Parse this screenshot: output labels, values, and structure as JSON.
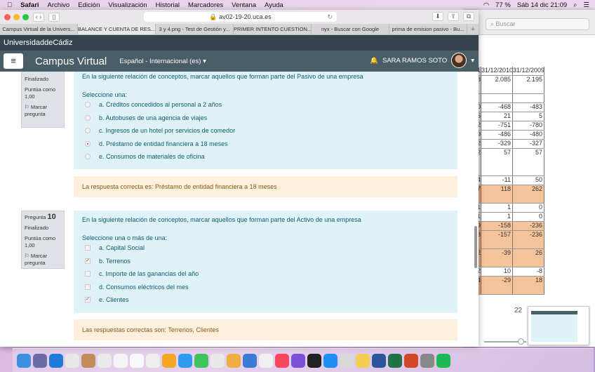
{
  "menubar": {
    "app": "Safari",
    "items": [
      "Archivo",
      "Edición",
      "Visualización",
      "Historial",
      "Marcadores",
      "Ventana",
      "Ayuda"
    ],
    "battery": "77 %",
    "datetime": "Sáb 14 dic  21:09"
  },
  "browser": {
    "url": "av02-19-20.uca.es",
    "tabs": [
      "Campus Virtual de la Univers...",
      "BALANCE Y CUENTA DE RES...",
      "3 y 4.png - Test de Gestión y...",
      "PRIMER INTENTO CUESTION...",
      "nyx - Buscar con Google",
      "prima de emision pasivo - Bu..."
    ]
  },
  "site": {
    "university": "UniversidaddeCádiz",
    "brand": "Campus Virtual",
    "language": "Español - Internacional (es)",
    "user": "SARA RAMOS SOTO"
  },
  "questions": [
    {
      "label": "Pregunta",
      "number": "9",
      "state": "Finalizado",
      "score": "Puntúa como 1,00",
      "flag": "Marcar pregunta",
      "text": "En la siguiente relación de conceptos, marcar aquellos que forman parte del Pasivo  de una empresa",
      "prompt": "Seleccione una:",
      "type": "radio",
      "options": [
        {
          "label": "a. Créditos concedidos al personal a 2 años",
          "checked": false
        },
        {
          "label": "b. Autobuses de una agencia de viajes",
          "checked": false
        },
        {
          "label": "c. Ingresos de un hotel por servicios de comedor",
          "checked": false
        },
        {
          "label": "d. Préstamo de entidad financiera a 18 meses",
          "checked": true
        },
        {
          "label": "e. Consumos de materiales de oficina",
          "checked": false
        }
      ],
      "feedback": "La respuesta correcta es: Préstamo de entidad financiera a 18 meses"
    },
    {
      "label": "Pregunta",
      "number": "10",
      "state": "Finalizado",
      "score": "Puntúa como 1,00",
      "flag": "Marcar pregunta",
      "text": "En la siguiente relación de conceptos, marcar aquellos que forman parte del Activo de una empresa",
      "prompt": "Seleccione una o más de una:",
      "type": "checkbox",
      "options": [
        {
          "label": "a. Capital Social",
          "checked": false
        },
        {
          "label": "b. Terrenos",
          "checked": true
        },
        {
          "label": "c. Importe de las ganancias del año",
          "checked": false
        },
        {
          "label": "d. Consumos eléctricos del mes",
          "checked": false
        },
        {
          "label": "e. Clientes",
          "checked": true
        }
      ],
      "feedback": "Las respuestas correctas son: Terrenos, Clientes"
    }
  ],
  "background_window": {
    "search_placeholder": "Buscar",
    "page_number": "22",
    "table": {
      "headers": [
        "1",
        "31/12/2010",
        "31/12/2009"
      ],
      "rows": [
        [
          "8",
          "2.085",
          "2.195",
          false,
          2
        ],
        [
          "",
          "",
          "",
          false,
          1
        ],
        [
          "0",
          "-468",
          "-483",
          false,
          1
        ],
        [
          "6",
          "21",
          "5",
          false,
          1
        ],
        [
          "2",
          "-751",
          "-780",
          false,
          1
        ],
        [
          "9",
          "-486",
          "-480",
          false,
          1
        ],
        [
          "2",
          "-329",
          "-327",
          false,
          1
        ],
        [
          "2",
          "57",
          "57",
          false,
          3
        ],
        [
          "4",
          "-11",
          "50",
          false,
          1
        ],
        [
          "7",
          "118",
          "262",
          true,
          2
        ],
        [
          "1",
          "1",
          "0",
          false,
          1
        ],
        [
          "1",
          "1",
          "0",
          false,
          1
        ],
        [
          "9",
          "-158",
          "-236",
          true,
          1
        ],
        [
          "8",
          "-157",
          "-236",
          true,
          2
        ],
        [
          "2",
          "-39",
          "26",
          true,
          2
        ],
        [
          "2",
          "10",
          "-8",
          false,
          1
        ],
        [
          "4",
          "-29",
          "18",
          true,
          2
        ]
      ]
    }
  }
}
